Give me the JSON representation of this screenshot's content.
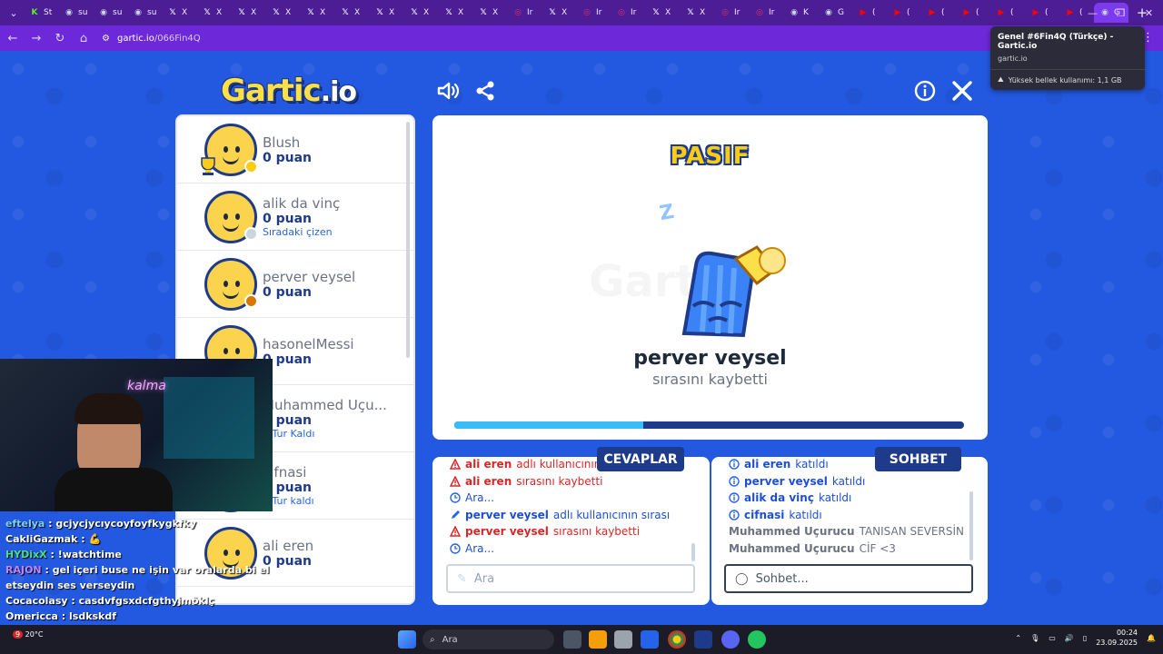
{
  "browser": {
    "tabs": [
      {
        "label": "St",
        "icon": "kick-icon",
        "color": "#53fc18"
      },
      {
        "label": "su",
        "icon": "globe-icon",
        "color": "#cbd5e1"
      },
      {
        "label": "su",
        "icon": "globe-icon",
        "color": "#cbd5e1"
      },
      {
        "label": "su",
        "icon": "globe-icon",
        "color": "#cbd5e1"
      },
      {
        "label": "X",
        "icon": "x-icon",
        "color": "#ffffff"
      },
      {
        "label": "X",
        "icon": "x-icon",
        "color": "#ffffff"
      },
      {
        "label": "X",
        "icon": "x-icon",
        "color": "#ffffff"
      },
      {
        "label": "X",
        "icon": "x-icon",
        "color": "#ffffff"
      },
      {
        "label": "X",
        "icon": "x-icon",
        "color": "#ffffff"
      },
      {
        "label": "X",
        "icon": "x-icon",
        "color": "#ffffff"
      },
      {
        "label": "X",
        "icon": "x-icon",
        "color": "#ffffff"
      },
      {
        "label": "X",
        "icon": "x-icon",
        "color": "#ffffff"
      },
      {
        "label": "X",
        "icon": "x-icon",
        "color": "#ffffff"
      },
      {
        "label": "X",
        "icon": "x-icon",
        "color": "#ffffff"
      },
      {
        "label": "Ir",
        "icon": "instagram-icon",
        "color": "#e1306c"
      },
      {
        "label": "X",
        "icon": "x-icon",
        "color": "#ffffff"
      },
      {
        "label": "Ir",
        "icon": "instagram-icon",
        "color": "#e1306c"
      },
      {
        "label": "Ir",
        "icon": "instagram-icon",
        "color": "#e1306c"
      },
      {
        "label": "X",
        "icon": "x-icon",
        "color": "#ffffff"
      },
      {
        "label": "X",
        "icon": "x-icon",
        "color": "#ffffff"
      },
      {
        "label": "Ir",
        "icon": "instagram-icon",
        "color": "#e1306c"
      },
      {
        "label": "Ir",
        "icon": "instagram-icon",
        "color": "#e1306c"
      },
      {
        "label": "K",
        "icon": "flag-icon",
        "color": "#cbd5e1"
      },
      {
        "label": "G",
        "icon": "gartic-icon",
        "color": "#cbd5e1"
      },
      {
        "label": "(",
        "icon": "youtube-icon",
        "color": "#ff0000"
      },
      {
        "label": "(",
        "icon": "youtube-icon",
        "color": "#ff0000"
      },
      {
        "label": "(",
        "icon": "youtube-icon",
        "color": "#ff0000"
      },
      {
        "label": "(",
        "icon": "youtube-icon",
        "color": "#ff0000"
      },
      {
        "label": "(",
        "icon": "youtube-icon",
        "color": "#ff0000"
      },
      {
        "label": "(",
        "icon": "youtube-icon",
        "color": "#ff0000"
      },
      {
        "label": "(",
        "icon": "youtube-icon",
        "color": "#ff0000"
      },
      {
        "label": "G",
        "icon": "gartic-icon",
        "color": "#cbd5e1",
        "active": true
      }
    ],
    "url_host": "gartic.io",
    "url_path": "/066Fin4Q",
    "tooltip_title": "Genel #6Fin4Q (Türkçe) - Gartic.io",
    "tooltip_host": "gartic.io",
    "tooltip_memory": "Yüksek bellek kullanımı: 1,1 GB"
  },
  "game": {
    "logo_main": "Gartic",
    "logo_suffix": ".io",
    "players": [
      {
        "name": "Blush",
        "score": "0 puan",
        "sub": "",
        "status_color": "#facc15",
        "trophy": true
      },
      {
        "name": "alik da vinç",
        "score": "0 puan",
        "sub": "Sıradaki çizen",
        "status_color": "#cbd5e1"
      },
      {
        "name": "perver veysel",
        "score": "0 puan",
        "sub": "",
        "status_color": "#d97706"
      },
      {
        "name": "hasonelMessi",
        "score": "0 puan",
        "sub": ""
      },
      {
        "name": "Muhammed Uçu...",
        "score": "0 puan",
        "sub": "1 Tur Kaldı"
      },
      {
        "name": "cifnasi",
        "score": "0 puan",
        "sub": "1 Tur kaldı"
      },
      {
        "name": "ali eren",
        "score": "0 puan",
        "sub": ""
      }
    ],
    "stage_status": "PASIF",
    "sleep_text": "Z",
    "watermark": "Gartic",
    "loser_name": "perver veysel",
    "loser_sub": "sırasını kaybetti",
    "progress_fraction": 0.37,
    "answers_label": "CEVAPLAR",
    "chat_label": "SOHBET",
    "answers": [
      {
        "type": "red",
        "bold": "ali eren",
        "text": "adlı kullanıcının sırası"
      },
      {
        "type": "red",
        "bold": "ali eren",
        "text": "sırasını kaybetti"
      },
      {
        "type": "clock",
        "bold": "",
        "text": "Ara..."
      },
      {
        "type": "pen",
        "bold": "perver veysel",
        "text": "adlı kullanıcının sırası"
      },
      {
        "type": "red",
        "bold": "perver veysel",
        "text": "sırasını kaybetti"
      },
      {
        "type": "clock",
        "bold": "",
        "text": "Ara..."
      }
    ],
    "chat": [
      {
        "type": "info",
        "bold": "ali eren",
        "text": "katıldı"
      },
      {
        "type": "info",
        "bold": "perver veysel",
        "text": "katıldı"
      },
      {
        "type": "info",
        "bold": "alik da vinç",
        "text": "katıldı"
      },
      {
        "type": "info",
        "bold": "cifnasi",
        "text": "katıldı"
      },
      {
        "type": "grey",
        "bold": "Muhammed Uçurucu",
        "text": "TANISAN SEVERSİN"
      },
      {
        "type": "grey",
        "bold": "Muhammed Uçurucu",
        "text": "CİF <3"
      }
    ],
    "answer_placeholder": "Ara",
    "chat_placeholder": "Sohbet..."
  },
  "stream": {
    "neon_sign": "kalma",
    "chat": [
      {
        "user": "eftelya",
        "color": "#7dd3fc",
        "text": "gcjycjycıycoyfoyfkygkfky"
      },
      {
        "user": "CakliGazmak",
        "color": "#ffffff",
        "text": "💪"
      },
      {
        "user": "HYDixX",
        "color": "#4ade80",
        "text": "!watchtime"
      },
      {
        "user": "RAJON",
        "color": "#c084fc",
        "text": "gel içeri buse ne işin var oralarda bi el etseydin ses verseydin"
      },
      {
        "user": "Cocacolasy",
        "color": "#ffffff",
        "text": "casdvfgsxdcfgthyjmöklç"
      },
      {
        "user": "Omericca",
        "color": "#ffffff",
        "text": "lsdkskdf"
      }
    ]
  },
  "taskbar": {
    "search_placeholder": "Ara",
    "weather_temp": "20°C",
    "time": "00:24",
    "date": "23.09.2025",
    "notification_count": "9"
  }
}
